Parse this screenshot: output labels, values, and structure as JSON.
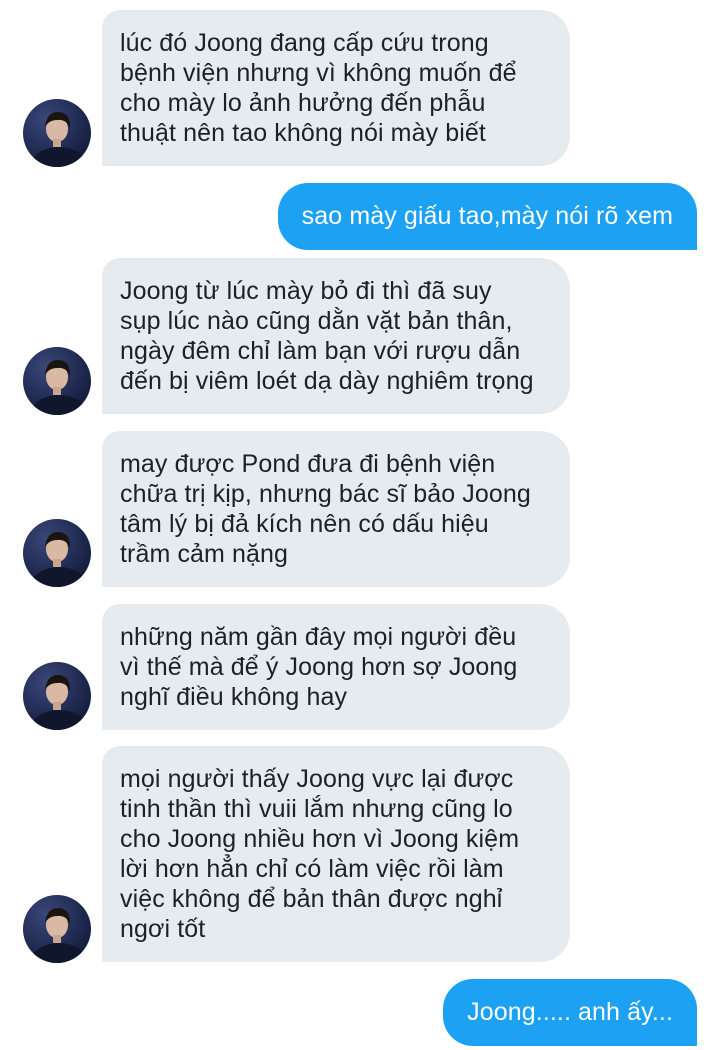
{
  "conversation": {
    "messages": [
      {
        "direction": "in",
        "text": "lúc đó Joong đang cấp cứu trong\nbệnh viện nhưng vì không muốn để\ncho mày lo ảnh hưởng đến phẫu\nthuật nên tao không nói mày biết"
      },
      {
        "direction": "out",
        "text": "sao mày giấu tao,mày nói rõ xem"
      },
      {
        "direction": "in",
        "text": "Joong từ lúc mày bỏ đi thì đã suy\nsụp lúc nào cũng dằn vặt bản thân,\nngày đêm chỉ làm bạn với rượu dẫn\nđến bị viêm loét dạ dày nghiêm trọng"
      },
      {
        "direction": "in",
        "text": "may được Pond đưa đi bệnh viện\nchữa trị kịp, nhưng bác sĩ bảo Joong\ntâm lý bị đả kích nên có dấu hiệu\ntrầm cảm nặng"
      },
      {
        "direction": "in",
        "text": "những năm gần đây mọi người đều\nvì thế mà để ý Joong hơn sợ Joong\nnghĩ điều không hay"
      },
      {
        "direction": "in",
        "text": "mọi người thấy Joong vực lại được\ntinh thần thì vuii lắm nhưng cũng lo\ncho Joong nhiều hơn vì Joong kiệm\nlời hơn hẳn chỉ có làm việc rồi làm\nviệc không để bản thân được nghỉ\nngơi tốt"
      },
      {
        "direction": "out",
        "text": "Joong..... anh ấy..."
      }
    ]
  },
  "colors": {
    "incoming_bubble": "#e6ebef",
    "outgoing_bubble": "#1da1f2",
    "incoming_text": "#1c2126",
    "outgoing_text": "#ffffff"
  },
  "icons": {
    "avatar": "contact-avatar-photo"
  }
}
